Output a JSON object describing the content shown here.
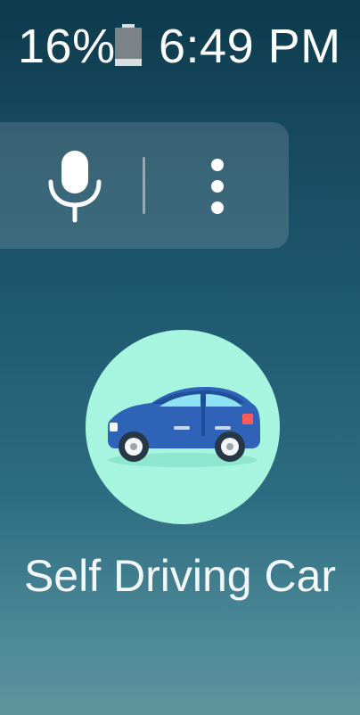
{
  "status_bar": {
    "battery_percent": "16%",
    "battery_icon": "battery-icon",
    "time": "6:49 PM"
  },
  "search_card": {
    "mic_icon": "microphone-icon",
    "more_icon": "more-vertical-icon"
  },
  "app": {
    "label": "Self Driving Car",
    "icon": "car-icon",
    "icon_background": "#a8f5df",
    "car_body_color": "#2f63b8"
  }
}
